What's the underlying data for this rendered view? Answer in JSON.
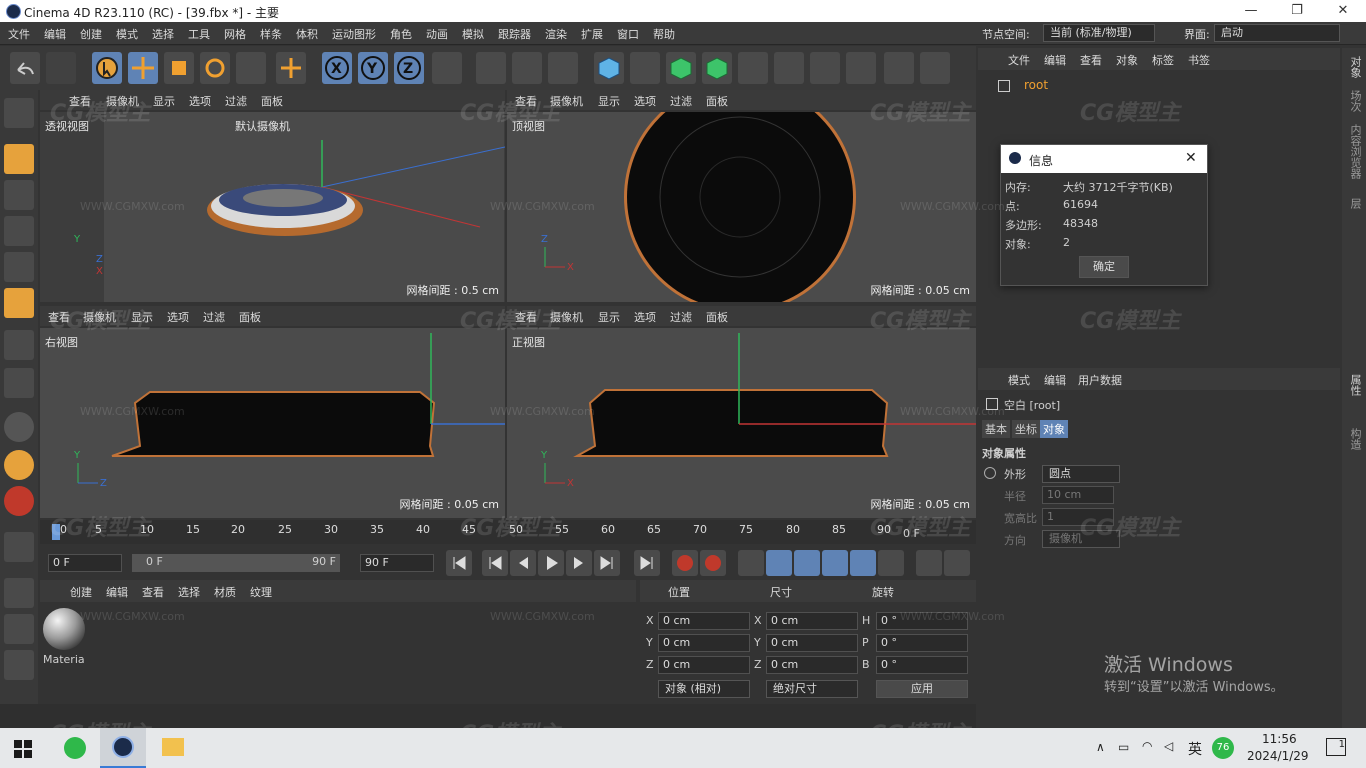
{
  "window": {
    "title": "Cinema 4D R23.110 (RC) - [39.fbx *] - 主要"
  },
  "menu": [
    "文件",
    "编辑",
    "创建",
    "模式",
    "选择",
    "工具",
    "网格",
    "样条",
    "体积",
    "运动图形",
    "角色",
    "动画",
    "模拟",
    "跟踪器",
    "渲染",
    "扩展",
    "窗口",
    "帮助"
  ],
  "node_space": {
    "label": "节点空间:",
    "value": "当前 (标准/物理)"
  },
  "layout": {
    "label": "界面:",
    "value": "启动"
  },
  "viewport_menu": [
    "查看",
    "摄像机",
    "显示",
    "选项",
    "过滤",
    "面板"
  ],
  "viewports": {
    "perspective": {
      "name": "透视视图",
      "camera": "默认摄像机",
      "grid": "网格间距 : 0.5 cm"
    },
    "top": {
      "name": "顶视图",
      "grid": "网格间距 : 0.05 cm"
    },
    "right": {
      "name": "右视图",
      "grid": "网格间距 : 0.05 cm"
    },
    "front": {
      "name": "正视图",
      "grid": "网格间距 : 0.05 cm"
    }
  },
  "object_manager": {
    "menu": [
      "文件",
      "编辑",
      "查看",
      "对象",
      "标签",
      "书签"
    ],
    "root": "root"
  },
  "info_dialog": {
    "title": "信息",
    "rows": [
      {
        "k": "内存:",
        "v": "大约 3712千字节(KB)"
      },
      {
        "k": "点:",
        "v": "61694"
      },
      {
        "k": "多边形:",
        "v": "48348"
      },
      {
        "k": "对象:",
        "v": "2"
      }
    ],
    "ok": "确定"
  },
  "attributes": {
    "menu": [
      "模式",
      "编辑",
      "用户数据"
    ],
    "object": "空白 [root]",
    "tabs": [
      "基本",
      "坐标",
      "对象"
    ],
    "section": "对象属性",
    "props": [
      {
        "label": "外形",
        "value": "圆点"
      },
      {
        "label": "半径",
        "value": "10 cm"
      },
      {
        "label": "宽高比",
        "value": "1"
      },
      {
        "label": "方向",
        "value": "摄像机"
      }
    ]
  },
  "side_tabs": [
    "对象",
    "场次",
    "内容浏览器",
    "层",
    "属性",
    "构造"
  ],
  "timeline": {
    "ticks": [
      "0",
      "5",
      "10",
      "15",
      "20",
      "25",
      "30",
      "35",
      "40",
      "45",
      "50",
      "55",
      "60",
      "65",
      "70",
      "75",
      "80",
      "85",
      "90"
    ],
    "end_frame": "0 F",
    "start": "0 F",
    "range_start": "0 F",
    "range_end": "90 F",
    "max": "90 F"
  },
  "materials": {
    "menu": [
      "创建",
      "编辑",
      "查看",
      "选择",
      "材质",
      "纹理"
    ],
    "item": "Materia"
  },
  "coords": {
    "headers": [
      "位置",
      "尺寸",
      "旋转"
    ],
    "rows": [
      {
        "a": "X",
        "p": "0 cm",
        "b": "X",
        "s": "0 cm",
        "c": "H",
        "r": "0 °"
      },
      {
        "a": "Y",
        "p": "0 cm",
        "b": "Y",
        "s": "0 cm",
        "c": "P",
        "r": "0 °"
      },
      {
        "a": "Z",
        "p": "0 cm",
        "b": "Z",
        "s": "0 cm",
        "c": "B",
        "r": "0 °"
      }
    ],
    "mode": "对象 (相对)",
    "size_mode": "绝对尺寸",
    "apply": "应用"
  },
  "activation": {
    "title": "激活 Windows",
    "sub": "转到“设置”以激活 Windows。"
  },
  "taskbar": {
    "time": "11:56",
    "date": "2024/1/29",
    "ime": "英",
    "badge": "76",
    "notif": "1"
  },
  "watermark": {
    "text": "CG模型主",
    "url": "WWW.CGMXW.com"
  }
}
